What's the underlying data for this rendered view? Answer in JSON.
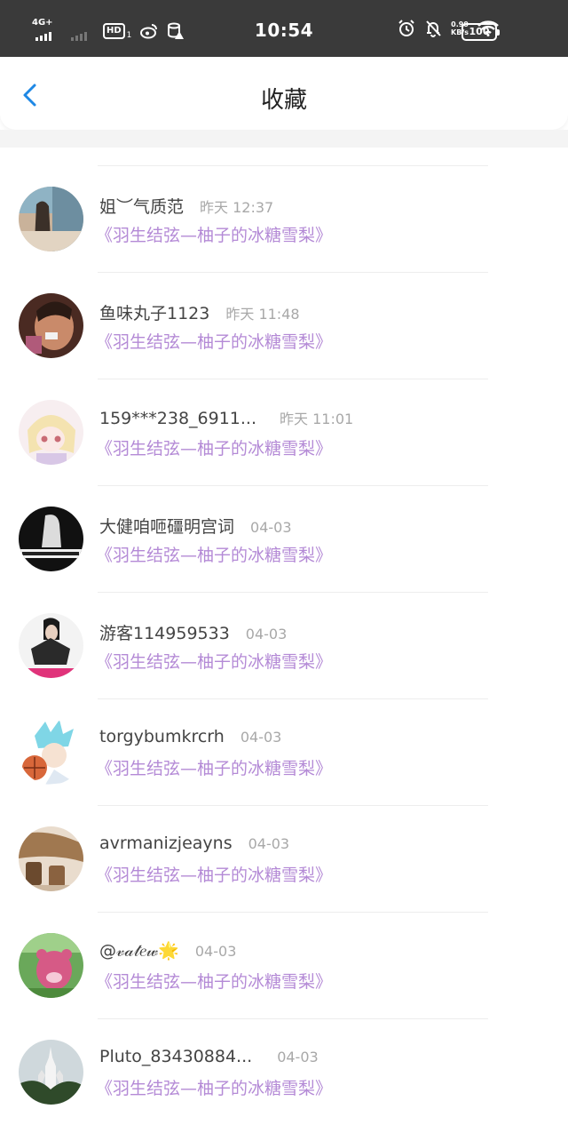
{
  "status_bar": {
    "network": "4G+",
    "hd": "HD",
    "sim": "1",
    "time": "10:54",
    "speed_value": "0.90",
    "speed_unit": "KB/s",
    "battery": "100"
  },
  "header": {
    "title": "收藏",
    "back_icon": "chevron-left-icon"
  },
  "colors": {
    "accent": "#1e88e5",
    "work_title": "#b48ad6",
    "status_bar_bg": "#3a3a3a"
  },
  "items": [
    {
      "name": "姐︶气质范",
      "time": "昨天 12:37",
      "work": "《羽生结弦—柚子的冰糖雪梨》"
    },
    {
      "name": "鱼味丸子1123",
      "time": "昨天 11:48",
      "work": "《羽生结弦—柚子的冰糖雪梨》"
    },
    {
      "name": "159***238_6911...",
      "time": "昨天 11:01",
      "work": "《羽生结弦—柚子的冰糖雪梨》"
    },
    {
      "name": "大健咱咂礓明宫词",
      "time": "04-03",
      "work": "《羽生结弦—柚子的冰糖雪梨》"
    },
    {
      "name": "游客114959533",
      "time": "04-03",
      "work": "《羽生结弦—柚子的冰糖雪梨》"
    },
    {
      "name": "torgybumkrcrh",
      "time": "04-03",
      "work": "《羽生结弦—柚子的冰糖雪梨》"
    },
    {
      "name": "avrmanizjeayns",
      "time": "04-03",
      "work": "《羽生结弦—柚子的冰糖雪梨》"
    },
    {
      "name": "@𝓋𝒶𝓉𝑒𝓌🌟",
      "time": "04-03",
      "work": "《羽生结弦—柚子的冰糖雪梨》"
    },
    {
      "name": "Pluto_83430884...",
      "time": "04-03",
      "work": "《羽生结弦—柚子的冰糖雪梨》"
    }
  ]
}
